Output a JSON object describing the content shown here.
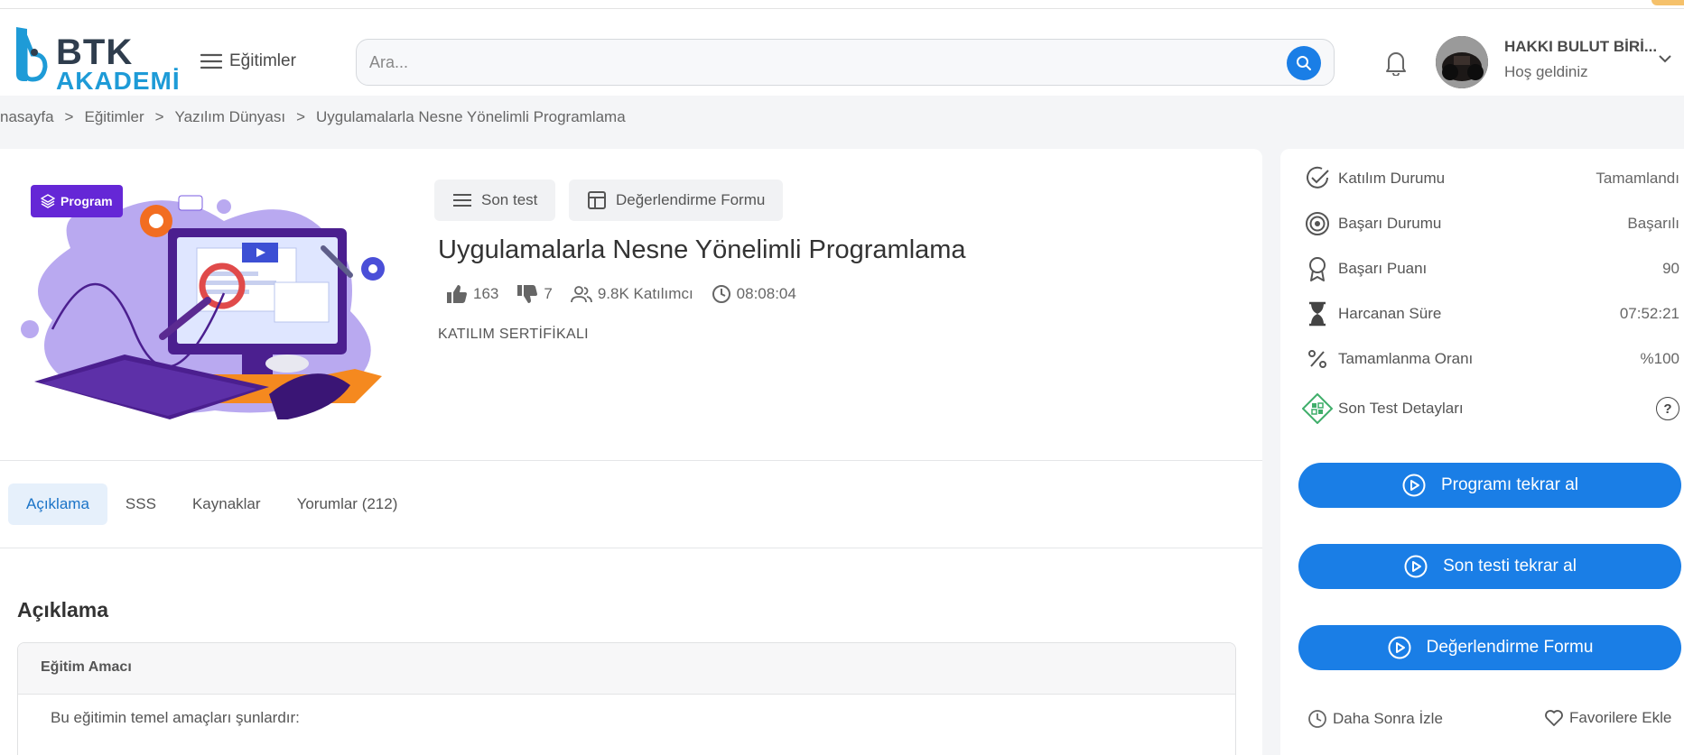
{
  "header": {
    "logo_line1": "BTK",
    "logo_line2": "AKADEMİ",
    "menu_label": "Eğitimler",
    "search_placeholder": "Ara...",
    "user_name": "HAKKI BULUT BİRİ...",
    "user_greeting": "Hoş geldiniz"
  },
  "breadcrumb": {
    "items": [
      "nasayfa",
      "Eğitimler",
      "Yazılım Dünyası",
      "Uygulamalarla Nesne Yönelimli Programlama"
    ],
    "separator": ">"
  },
  "course": {
    "badge": "Program",
    "actions": [
      "Son test",
      "Değerlendirme Formu"
    ],
    "title": "Uygulamalarla Nesne Yönelimli Programlama",
    "likes": "163",
    "dislikes": "7",
    "participants": "9.8K Katılımcı",
    "duration": "08:08:04",
    "certificate": "KATILIM SERTİFİKALI"
  },
  "tabs": [
    {
      "label": "Açıklama",
      "active": true
    },
    {
      "label": "SSS",
      "active": false
    },
    {
      "label": "Kaynaklar",
      "active": false
    },
    {
      "label": "Yorumlar (212)",
      "active": false
    }
  ],
  "content": {
    "section_title": "Açıklama",
    "box_title": "Eğitim Amacı",
    "box_text": "Bu eğitimin temel amaçları şunlardır:"
  },
  "sidebar": {
    "rows": [
      {
        "label": "Katılım Durumu",
        "value": "Tamamlandı",
        "icon": "check-circle-icon"
      },
      {
        "label": "Başarı Durumu",
        "value": "Başarılı",
        "icon": "target-icon"
      },
      {
        "label": "Başarı Puanı",
        "value": "90",
        "icon": "award-icon"
      },
      {
        "label": "Harcanan Süre",
        "value": "07:52:21",
        "icon": "hourglass-icon"
      },
      {
        "label": "Tamamlanma Oranı",
        "value": "%100",
        "icon": "percent-icon"
      },
      {
        "label": "Son Test Detayları",
        "value": "?",
        "icon": "qr-icon"
      }
    ],
    "buttons": [
      "Programı tekrar al",
      "Son testi tekrar al",
      "Değerlendirme Formu"
    ],
    "watch_later": "Daha Sonra İzle",
    "favorite": "Favorilere Ekle"
  },
  "colors": {
    "primary": "#1a7ee6",
    "badge": "#6527d6",
    "logo_dark": "#2f3d4d",
    "logo_blue": "#1e9bd7"
  }
}
